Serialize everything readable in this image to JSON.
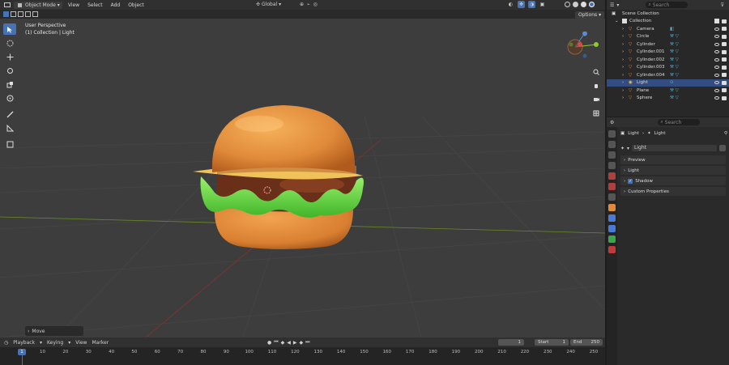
{
  "header": {
    "mode": "Object Mode",
    "menus": [
      "View",
      "Select",
      "Add",
      "Object"
    ],
    "transform_orientation": "Global",
    "options_label": "Options"
  },
  "viewport": {
    "perspective_label": "User Perspective",
    "context_label": "(1) Collection | Light",
    "last_operator": "Move"
  },
  "outliner": {
    "search_placeholder": "Search",
    "root": "Scene Collection",
    "collection": "Collection",
    "items": [
      {
        "name": "Camera",
        "selected": false
      },
      {
        "name": "Circle",
        "selected": false
      },
      {
        "name": "Cylinder",
        "selected": false
      },
      {
        "name": "Cylinder.001",
        "selected": false
      },
      {
        "name": "Cylinder.002",
        "selected": false
      },
      {
        "name": "Cylinder.003",
        "selected": false
      },
      {
        "name": "Cylinder.004",
        "selected": false
      },
      {
        "name": "Light",
        "selected": true
      },
      {
        "name": "Plane",
        "selected": false
      },
      {
        "name": "Sphere",
        "selected": false
      }
    ]
  },
  "properties": {
    "search_placeholder": "Search",
    "breadcrumb_object": "Light",
    "breadcrumb_data": "Light",
    "datablock_name": "Light",
    "panels": {
      "preview": "Preview",
      "light": "Light",
      "shadow": "Shadow",
      "custom": "Custom Properties"
    }
  },
  "timeline": {
    "menus": [
      "Playback",
      "Keying",
      "View",
      "Marker"
    ],
    "current_frame": "1",
    "start_label": "Start",
    "start": "1",
    "end_label": "End",
    "end": "250",
    "ruler_ticks": [
      "1",
      "10",
      "20",
      "30",
      "40",
      "50",
      "60",
      "70",
      "80",
      "90",
      "100",
      "110",
      "120",
      "130",
      "140",
      "150",
      "160",
      "170",
      "180",
      "190",
      "200",
      "210",
      "220",
      "230",
      "240",
      "250"
    ]
  },
  "colors": {
    "accent": "#4772b3",
    "bun": "#e08a3a",
    "lettuce": "#5fd43a",
    "patty": "#7a3a1f",
    "cheese": "#f0c35a"
  }
}
